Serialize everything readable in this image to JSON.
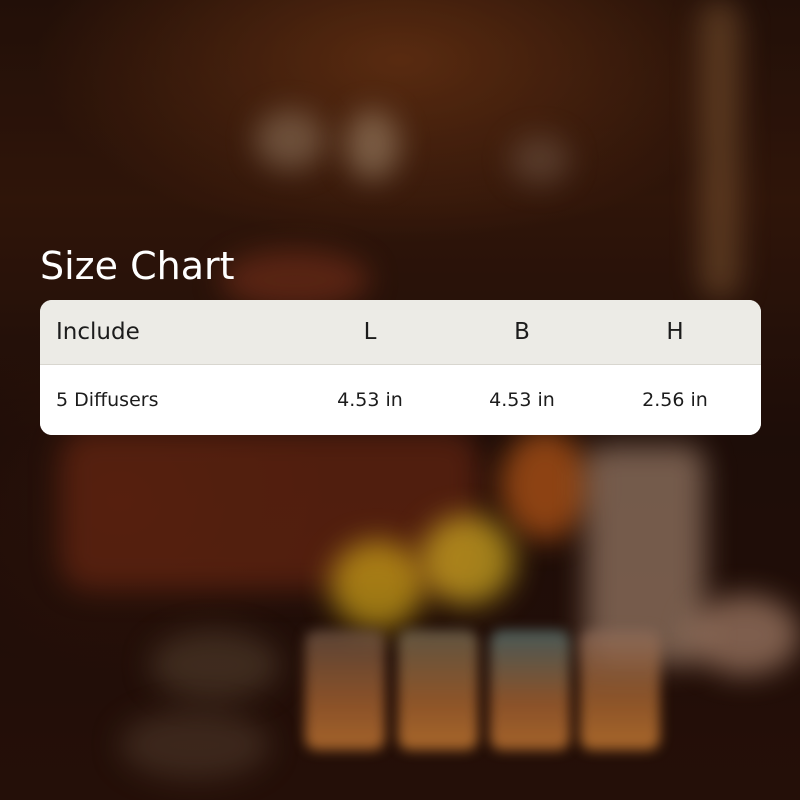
{
  "title": "Size Chart",
  "table": {
    "headers": [
      "Include",
      "L",
      "B",
      "H"
    ],
    "rows": [
      [
        "5 Diffusers",
        "4.53 in",
        "4.53 in",
        "2.56 in"
      ]
    ]
  },
  "colors": {
    "title_text": "#ffffff",
    "header_row_bg": "#ecebe6",
    "body_row_bg": "#ffffff",
    "cell_text": "#1c1c1c"
  }
}
